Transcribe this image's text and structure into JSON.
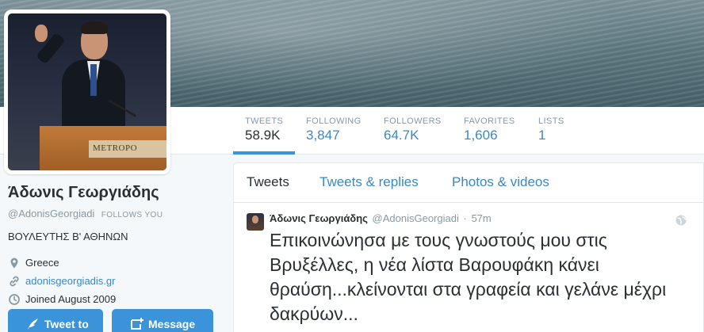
{
  "profile": {
    "name": "Άδωνις Γεωργιάδης",
    "handle": "@AdonisGeorgiadi",
    "follows_you": "FOLLOWS YOU",
    "bio": "ΒΟΥΛΕΥΤΗΣ Β' ΑΘΗΝΩΝ",
    "location": "Greece",
    "website": "adonisgeorgiadis.gr",
    "joined": "Joined August 2009",
    "avatar_sign": "METROPO"
  },
  "stats": [
    {
      "label": "TWEETS",
      "value": "58.9K"
    },
    {
      "label": "FOLLOWING",
      "value": "3,847"
    },
    {
      "label": "FOLLOWERS",
      "value": "64.7K"
    },
    {
      "label": "FAVORITES",
      "value": "1,606"
    },
    {
      "label": "LISTS",
      "value": "1"
    }
  ],
  "tabs": [
    "Tweets",
    "Tweets & replies",
    "Photos & videos"
  ],
  "actions": {
    "tweet_to": "Tweet to",
    "message": "Message"
  },
  "tweet": {
    "name": "Άδωνις Γεωργιάδης",
    "handle": "@AdonisGeorgiadi",
    "separator": "·",
    "time": "57m",
    "text": "Επικοινώνησα με τους γνωστούς μου στις Βρυξέλλες, η νέα λίστα Βαρουφάκη κάνει θραύση...κλείνονται στα γραφεία και γελάνε μέχρι δακρύων..."
  },
  "colors": {
    "accent": "#3b94d9",
    "link": "#3b88c3",
    "muted": "#8899a6"
  }
}
